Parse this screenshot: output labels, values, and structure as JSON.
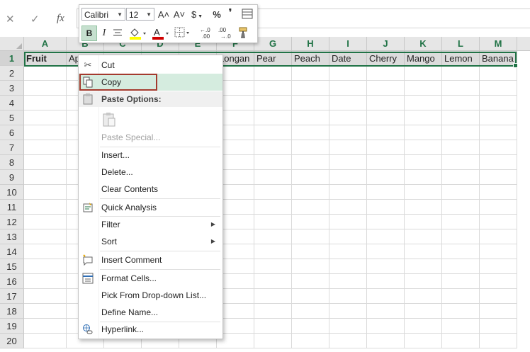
{
  "formula_bar": {
    "cancel": "✕",
    "enter": "✓",
    "fx": "fx",
    "value": ""
  },
  "columns": [
    "A",
    "B",
    "C",
    "D",
    "E",
    "F",
    "G",
    "H",
    "I",
    "J",
    "K",
    "L",
    "M"
  ],
  "rows": [
    "1",
    "2",
    "3",
    "4",
    "5",
    "6",
    "7",
    "8",
    "9",
    "10",
    "11",
    "12",
    "13",
    "14",
    "15",
    "16",
    "17",
    "18",
    "19",
    "20"
  ],
  "row1": [
    "Fruit",
    "Ap",
    "",
    "",
    "",
    "Longan",
    "Pear",
    "Peach",
    "Date",
    "Cherry",
    "Mango",
    "Lemon",
    "Banana"
  ],
  "mini_toolbar": {
    "font": "Calibri",
    "size": "12",
    "grow": "A˄",
    "shrink": "A˅",
    "currency": "$",
    "percent": "%",
    "comma": "❜",
    "bold": "B",
    "italic": "I"
  },
  "menu": {
    "cut": "Cut",
    "copy": "Copy",
    "paste_options": "Paste Options:",
    "paste_special": "Paste Special...",
    "insert": "Insert...",
    "delete": "Delete...",
    "clear_contents": "Clear Contents",
    "quick_analysis": "Quick Analysis",
    "filter": "Filter",
    "sort": "Sort",
    "insert_comment": "Insert Comment",
    "format_cells": "Format Cells...",
    "pick_from_list": "Pick From Drop-down List...",
    "define_name": "Define Name...",
    "hyperlink": "Hyperlink..."
  },
  "colors": {
    "accent": "#217346",
    "copy_outline": "#a33a2e",
    "copy_highlight": "#d5ecdf"
  }
}
